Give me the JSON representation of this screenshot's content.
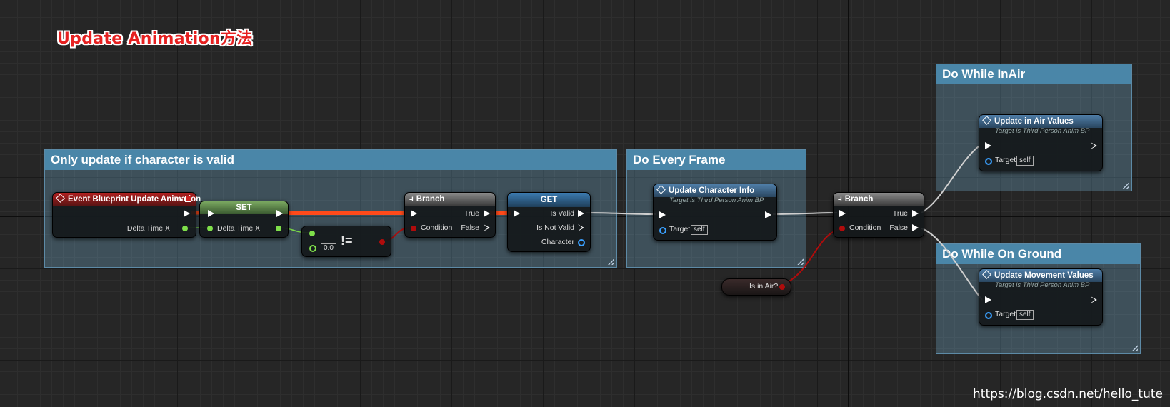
{
  "page": {
    "title": "Update Animation方法",
    "watermark": "https://blog.csdn.net/hello_tute"
  },
  "colors": {
    "comment_header": "#4a86a8",
    "exec_wire": "#ffffff",
    "exec_wire_active": "#ff4a1a",
    "float_pin": "#7fe04a",
    "bool_pin": "#b00c0c",
    "object_pin": "#3aa0ff"
  },
  "comments": {
    "valid": "Only update if character is valid",
    "every_frame": "Do Every Frame",
    "in_air": "Do While InAir",
    "on_ground": "Do While On Ground"
  },
  "event_node": {
    "title": "Event Blueprint Update Animation",
    "out_pin": "Delta Time X",
    "icon": "event-diamond-icon"
  },
  "set_node": {
    "title": "SET",
    "pin": "Delta Time X"
  },
  "neq_node": {
    "symbol": "!=",
    "value": "0.0"
  },
  "branch1": {
    "title": "Branch",
    "condition": "Condition",
    "true": "True",
    "false": "False"
  },
  "get_node": {
    "title": "GET",
    "is_valid": "Is Valid",
    "is_not_valid": "Is Not Valid",
    "character": "Character"
  },
  "update_char": {
    "title": "Update Character Info",
    "subtitle": "Target is Third Person Anim BP",
    "target": "Target",
    "self": "self"
  },
  "is_in_air": {
    "label": "Is in Air?"
  },
  "branch2": {
    "title": "Branch",
    "condition": "Condition",
    "true": "True",
    "false": "False"
  },
  "update_air": {
    "title": "Update in Air Values",
    "subtitle": "Target is Third Person Anim BP",
    "target": "Target",
    "self": "self"
  },
  "update_move": {
    "title": "Update Movement Values",
    "subtitle": "Target is Third Person Anim BP",
    "target": "Target",
    "self": "self"
  }
}
